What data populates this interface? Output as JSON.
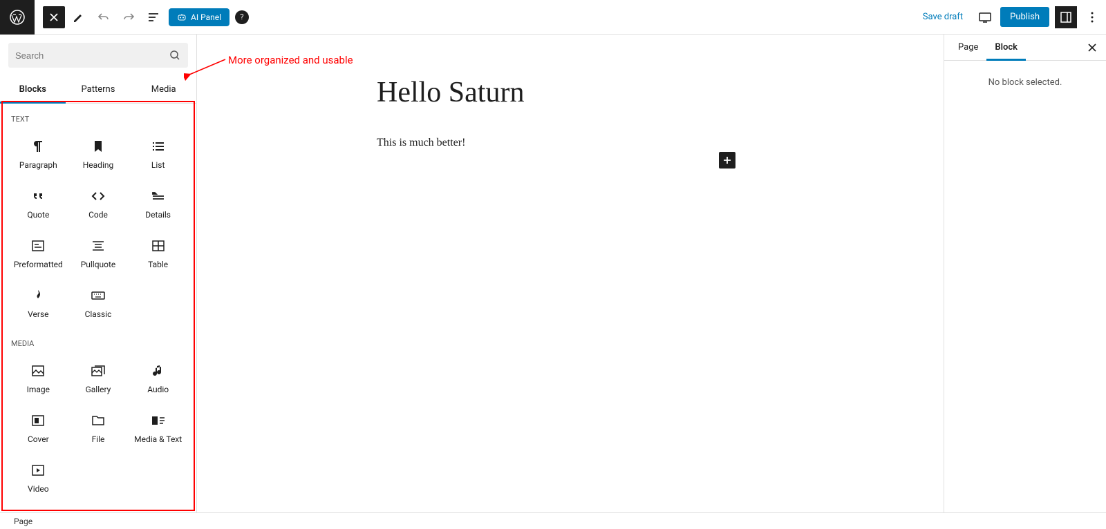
{
  "topbar": {
    "ai_panel": "AI Panel",
    "save_draft": "Save draft",
    "publish": "Publish"
  },
  "inserter": {
    "search_placeholder": "Search",
    "tabs": [
      "Blocks",
      "Patterns",
      "Media"
    ],
    "categories": [
      {
        "label": "TEXT",
        "blocks": [
          "Paragraph",
          "Heading",
          "List",
          "Quote",
          "Code",
          "Details",
          "Preformatted",
          "Pullquote",
          "Table",
          "Verse",
          "Classic"
        ]
      },
      {
        "label": "MEDIA",
        "blocks": [
          "Image",
          "Gallery",
          "Audio",
          "Cover",
          "File",
          "Media & Text",
          "Video"
        ]
      }
    ]
  },
  "canvas": {
    "title": "Hello Saturn",
    "body": "This is much better!"
  },
  "settings": {
    "tabs": [
      "Page",
      "Block"
    ],
    "empty_msg": "No block selected."
  },
  "statusbar": {
    "text": "Page"
  },
  "annotation": {
    "text": "More organized and usable"
  }
}
